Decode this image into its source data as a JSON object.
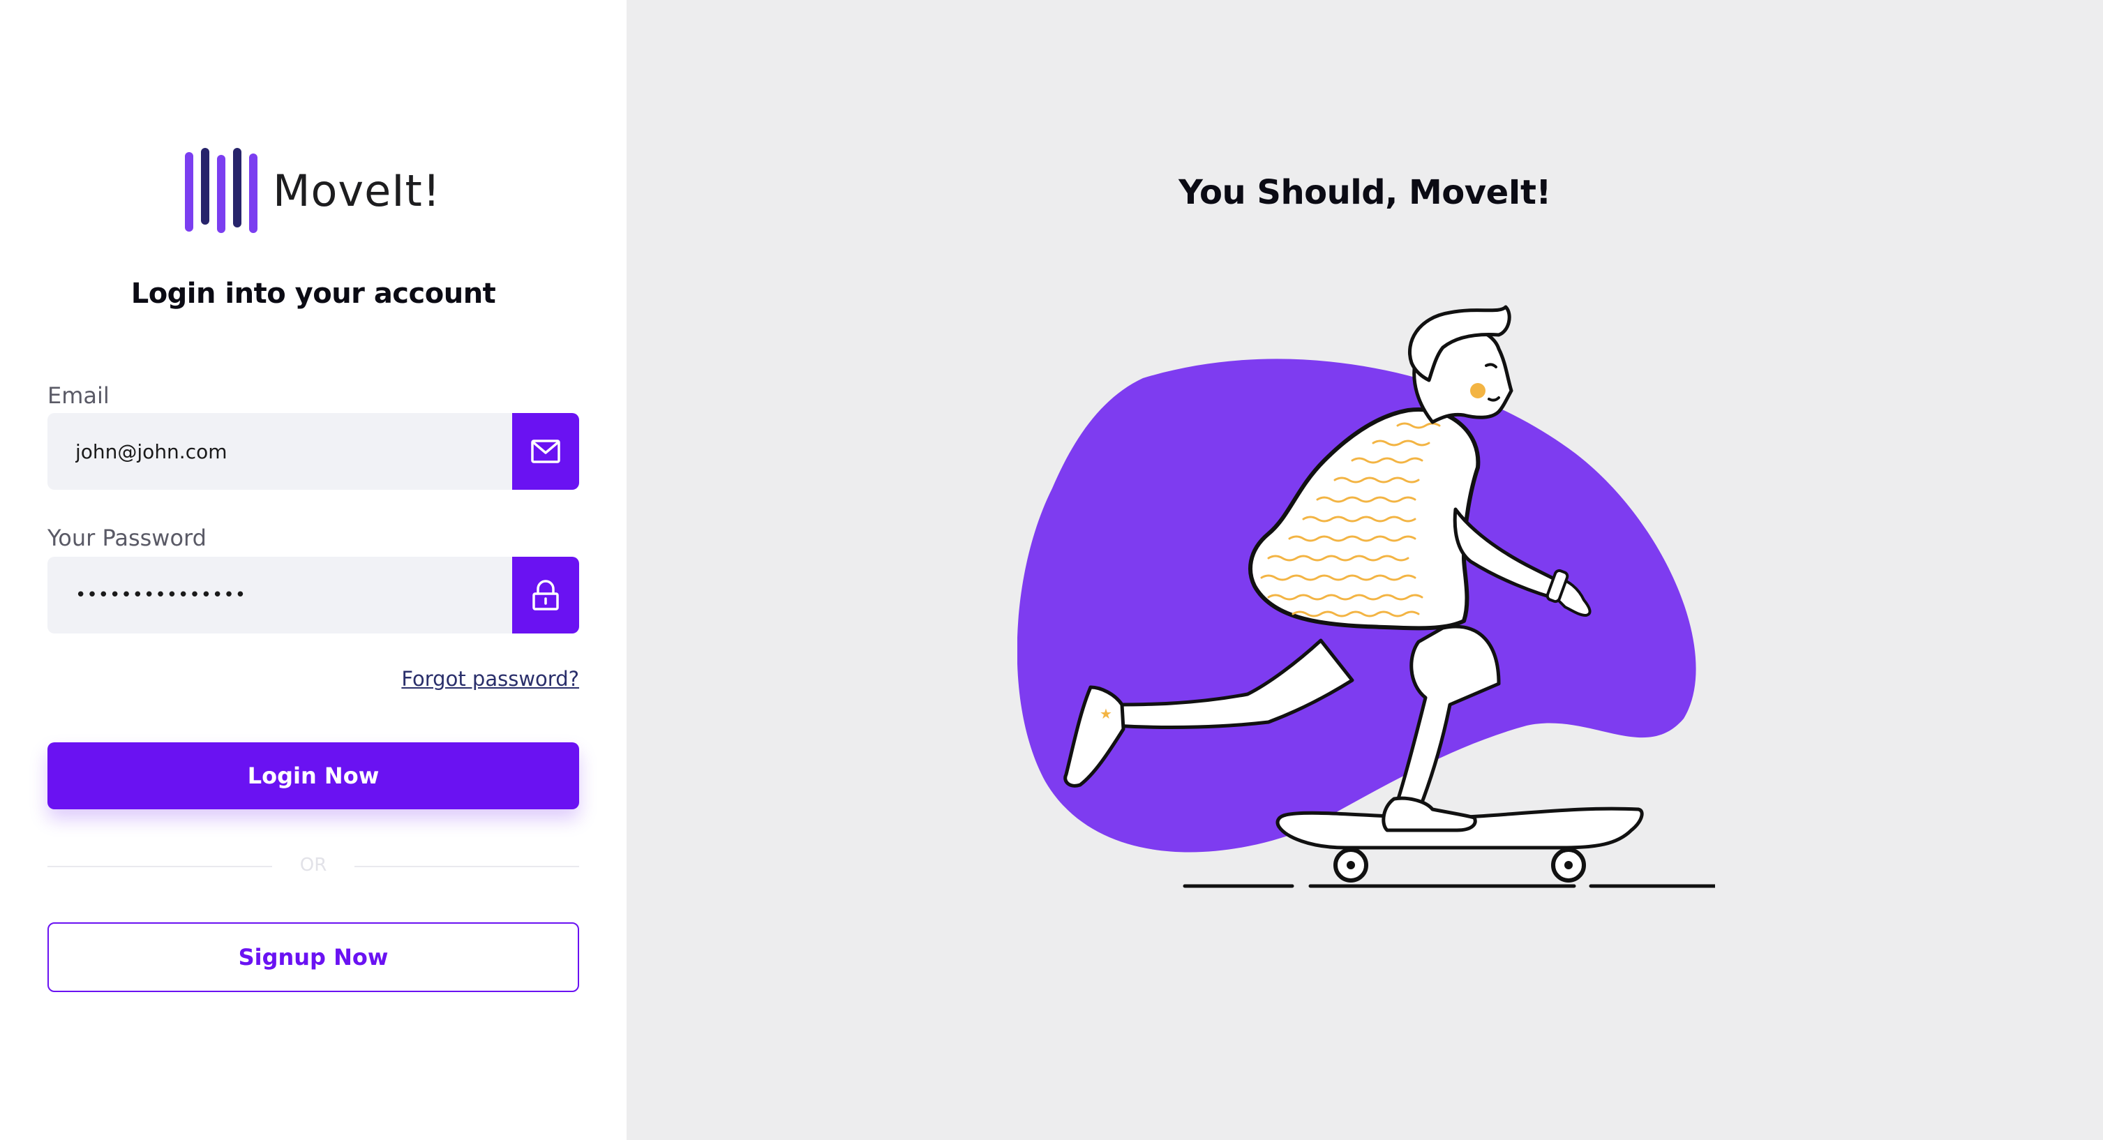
{
  "brand": {
    "name": "MoveIt!",
    "accent_color": "#6a12f2",
    "logo_bar_colors": [
      "#7b3ef0",
      "#27246b",
      "#7b3ef0",
      "#27246b",
      "#7b3ef0"
    ]
  },
  "login": {
    "heading": "Login into your account",
    "email": {
      "label": "Email",
      "value": "john@john.com",
      "icon": "mail-icon"
    },
    "password": {
      "label": "Your Password",
      "value": "•••••••••••••••",
      "icon": "lock-icon"
    },
    "forgot_password": "Forgot password?",
    "login_button": "Login Now",
    "divider": "OR",
    "signup_button": "Signup Now"
  },
  "hero": {
    "title": "You Should, MoveIt!",
    "illustration": "skateboarder-illustration",
    "blob_color": "#7e3cf0",
    "accent_color": "#f3b443"
  }
}
